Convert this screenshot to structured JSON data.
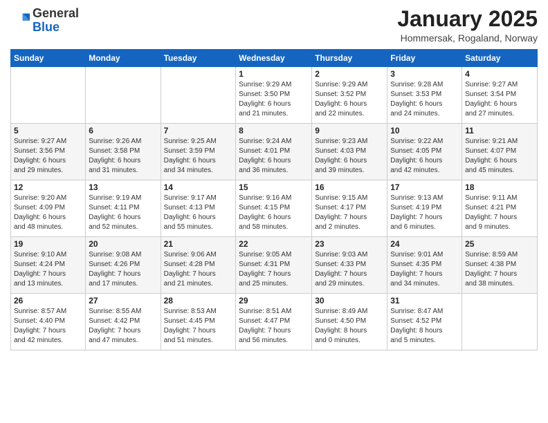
{
  "logo": {
    "general": "General",
    "blue": "Blue"
  },
  "header": {
    "title": "January 2025",
    "subtitle": "Hommersak, Rogaland, Norway"
  },
  "days_of_week": [
    "Sunday",
    "Monday",
    "Tuesday",
    "Wednesday",
    "Thursday",
    "Friday",
    "Saturday"
  ],
  "weeks": [
    [
      {
        "day": "",
        "info": ""
      },
      {
        "day": "",
        "info": ""
      },
      {
        "day": "",
        "info": ""
      },
      {
        "day": "1",
        "info": "Sunrise: 9:29 AM\nSunset: 3:50 PM\nDaylight: 6 hours\nand 21 minutes."
      },
      {
        "day": "2",
        "info": "Sunrise: 9:29 AM\nSunset: 3:52 PM\nDaylight: 6 hours\nand 22 minutes."
      },
      {
        "day": "3",
        "info": "Sunrise: 9:28 AM\nSunset: 3:53 PM\nDaylight: 6 hours\nand 24 minutes."
      },
      {
        "day": "4",
        "info": "Sunrise: 9:27 AM\nSunset: 3:54 PM\nDaylight: 6 hours\nand 27 minutes."
      }
    ],
    [
      {
        "day": "5",
        "info": "Sunrise: 9:27 AM\nSunset: 3:56 PM\nDaylight: 6 hours\nand 29 minutes."
      },
      {
        "day": "6",
        "info": "Sunrise: 9:26 AM\nSunset: 3:58 PM\nDaylight: 6 hours\nand 31 minutes."
      },
      {
        "day": "7",
        "info": "Sunrise: 9:25 AM\nSunset: 3:59 PM\nDaylight: 6 hours\nand 34 minutes."
      },
      {
        "day": "8",
        "info": "Sunrise: 9:24 AM\nSunset: 4:01 PM\nDaylight: 6 hours\nand 36 minutes."
      },
      {
        "day": "9",
        "info": "Sunrise: 9:23 AM\nSunset: 4:03 PM\nDaylight: 6 hours\nand 39 minutes."
      },
      {
        "day": "10",
        "info": "Sunrise: 9:22 AM\nSunset: 4:05 PM\nDaylight: 6 hours\nand 42 minutes."
      },
      {
        "day": "11",
        "info": "Sunrise: 9:21 AM\nSunset: 4:07 PM\nDaylight: 6 hours\nand 45 minutes."
      }
    ],
    [
      {
        "day": "12",
        "info": "Sunrise: 9:20 AM\nSunset: 4:09 PM\nDaylight: 6 hours\nand 48 minutes."
      },
      {
        "day": "13",
        "info": "Sunrise: 9:19 AM\nSunset: 4:11 PM\nDaylight: 6 hours\nand 52 minutes."
      },
      {
        "day": "14",
        "info": "Sunrise: 9:17 AM\nSunset: 4:13 PM\nDaylight: 6 hours\nand 55 minutes."
      },
      {
        "day": "15",
        "info": "Sunrise: 9:16 AM\nSunset: 4:15 PM\nDaylight: 6 hours\nand 58 minutes."
      },
      {
        "day": "16",
        "info": "Sunrise: 9:15 AM\nSunset: 4:17 PM\nDaylight: 7 hours\nand 2 minutes."
      },
      {
        "day": "17",
        "info": "Sunrise: 9:13 AM\nSunset: 4:19 PM\nDaylight: 7 hours\nand 6 minutes."
      },
      {
        "day": "18",
        "info": "Sunrise: 9:11 AM\nSunset: 4:21 PM\nDaylight: 7 hours\nand 9 minutes."
      }
    ],
    [
      {
        "day": "19",
        "info": "Sunrise: 9:10 AM\nSunset: 4:24 PM\nDaylight: 7 hours\nand 13 minutes."
      },
      {
        "day": "20",
        "info": "Sunrise: 9:08 AM\nSunset: 4:26 PM\nDaylight: 7 hours\nand 17 minutes."
      },
      {
        "day": "21",
        "info": "Sunrise: 9:06 AM\nSunset: 4:28 PM\nDaylight: 7 hours\nand 21 minutes."
      },
      {
        "day": "22",
        "info": "Sunrise: 9:05 AM\nSunset: 4:31 PM\nDaylight: 7 hours\nand 25 minutes."
      },
      {
        "day": "23",
        "info": "Sunrise: 9:03 AM\nSunset: 4:33 PM\nDaylight: 7 hours\nand 29 minutes."
      },
      {
        "day": "24",
        "info": "Sunrise: 9:01 AM\nSunset: 4:35 PM\nDaylight: 7 hours\nand 34 minutes."
      },
      {
        "day": "25",
        "info": "Sunrise: 8:59 AM\nSunset: 4:38 PM\nDaylight: 7 hours\nand 38 minutes."
      }
    ],
    [
      {
        "day": "26",
        "info": "Sunrise: 8:57 AM\nSunset: 4:40 PM\nDaylight: 7 hours\nand 42 minutes."
      },
      {
        "day": "27",
        "info": "Sunrise: 8:55 AM\nSunset: 4:42 PM\nDaylight: 7 hours\nand 47 minutes."
      },
      {
        "day": "28",
        "info": "Sunrise: 8:53 AM\nSunset: 4:45 PM\nDaylight: 7 hours\nand 51 minutes."
      },
      {
        "day": "29",
        "info": "Sunrise: 8:51 AM\nSunset: 4:47 PM\nDaylight: 7 hours\nand 56 minutes."
      },
      {
        "day": "30",
        "info": "Sunrise: 8:49 AM\nSunset: 4:50 PM\nDaylight: 8 hours\nand 0 minutes."
      },
      {
        "day": "31",
        "info": "Sunrise: 8:47 AM\nSunset: 4:52 PM\nDaylight: 8 hours\nand 5 minutes."
      },
      {
        "day": "",
        "info": ""
      }
    ]
  ]
}
